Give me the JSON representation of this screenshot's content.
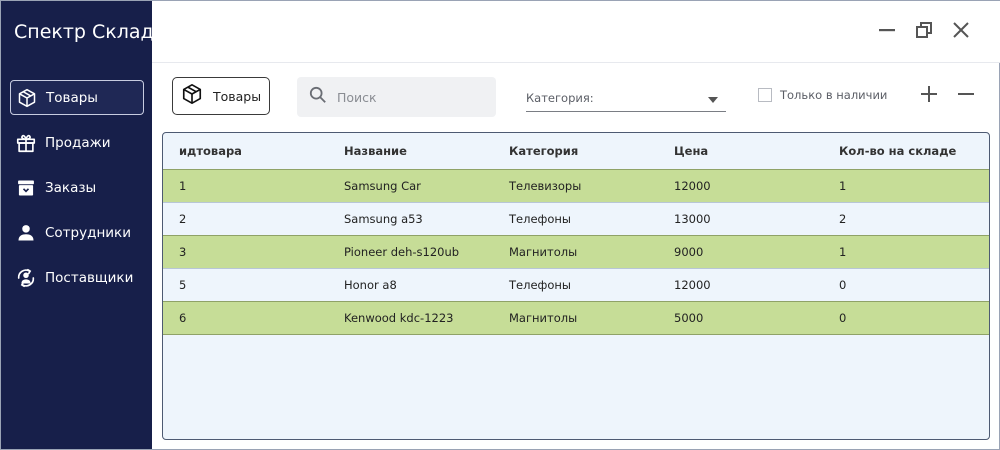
{
  "app": {
    "title": "Спектр Склад"
  },
  "sidebar": {
    "items": [
      {
        "label": "Товары",
        "icon": "box-icon",
        "active": true
      },
      {
        "label": "Продажи",
        "icon": "gift-icon",
        "active": false
      },
      {
        "label": "Заказы",
        "icon": "archive-icon",
        "active": false
      },
      {
        "label": "Сотрудники",
        "icon": "person-icon",
        "active": false
      },
      {
        "label": "Поставщики",
        "icon": "supplier-icon",
        "active": false
      }
    ]
  },
  "toolbar": {
    "tab_label": "Товары",
    "search_placeholder": "Поиск",
    "category_label": "Категория:",
    "in_stock_label": "Только в наличии",
    "in_stock_checked": false
  },
  "table": {
    "columns": [
      "идтовара",
      "Название",
      "Категория",
      "Цена",
      "Кол-во на складе"
    ],
    "rows": [
      [
        "1",
        "Samsung Car",
        "Телевизоры",
        "12000",
        "1"
      ],
      [
        "2",
        "Samsung a53",
        "Телефоны",
        "13000",
        "2"
      ],
      [
        "3",
        "Pioneer deh-s120ub",
        "Магнитолы",
        "9000",
        "1"
      ],
      [
        "5",
        "Honor a8",
        "Телефоны",
        "12000",
        "0"
      ],
      [
        "6",
        "Kenwood kdc-1223",
        "Магнитолы",
        "5000",
        "0"
      ]
    ]
  },
  "colors": {
    "sidebar_bg": "#171f4a",
    "row_highlight": "#c6dd97",
    "row_plain": "#eef5fc"
  }
}
